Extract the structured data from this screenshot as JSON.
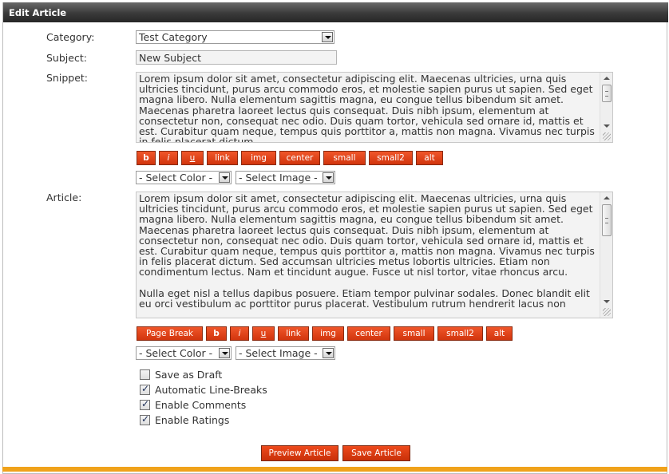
{
  "panel": {
    "title": "Edit Article"
  },
  "form": {
    "category_label": "Category:",
    "category_value": "Test Category",
    "subject_label": "Subject:",
    "subject_value": "New Subject",
    "snippet_label": "Snippet:",
    "snippet_text": "Lorem ipsum dolor sit amet, consectetur adipiscing elit. Maecenas ultricies, urna quis ultricies tincidunt, purus arcu commodo eros, et molestie sapien purus ut sapien. Sed eget magna libero. Nulla elementum sagittis magna, eu congue tellus bibendum sit amet. Maecenas pharetra laoreet lectus quis consequat. Duis nibh ipsum, elementum at consectetur non, consequat nec odio. Duis quam tortor, vehicula sed ornare id, mattis et est. Curabitur quam neque, tempus quis porttitor a, mattis non magna. Vivamus nec turpis in felis placerat dictum.",
    "article_label": "Article:",
    "article_text": "Lorem ipsum dolor sit amet, consectetur adipiscing elit. Maecenas ultricies, urna quis ultricies tincidunt, purus arcu commodo eros, et molestie sapien purus ut sapien. Sed eget magna libero. Nulla elementum sagittis magna, eu congue tellus bibendum sit amet. Maecenas pharetra laoreet lectus quis consequat. Duis nibh ipsum, elementum at consectetur non, consequat nec odio. Duis quam tortor, vehicula sed ornare id, mattis et est. Curabitur quam neque, tempus quis porttitor a, mattis non magna. Vivamus nec turpis in felis placerat dictum. Sed accumsan ultricies metus lobortis ultricies. Etiam non condimentum lectus. Nam et tincidunt augue. Fusce ut nisl tortor, vitae rhoncus arcu.\n\nNulla eget nisl a tellus dapibus posuere. Etiam tempor pulvinar sodales. Donec blandit elit eu orci vestibulum ac porttitor purus placerat. Vestibulum rutrum hendrerit lacus non"
  },
  "snippet_toolbar": {
    "bold": "b",
    "italic": "i",
    "underline": "u",
    "link": "link",
    "img": "img",
    "center": "center",
    "small": "small",
    "small2": "small2",
    "alt": "alt",
    "color_select": "- Select Color -",
    "image_select": "- Select Image -"
  },
  "article_toolbar": {
    "page_break": "Page Break",
    "bold": "b",
    "italic": "i",
    "underline": "u",
    "link": "link",
    "img": "img",
    "center": "center",
    "small": "small",
    "small2": "small2",
    "alt": "alt",
    "color_select": "- Select Color -",
    "image_select": "- Select Image -"
  },
  "options": [
    {
      "label": "Save as Draft",
      "checked": false
    },
    {
      "label": "Automatic Line-Breaks",
      "checked": true
    },
    {
      "label": "Enable Comments",
      "checked": true
    },
    {
      "label": "Enable Ratings",
      "checked": true
    }
  ],
  "actions": {
    "preview": "Preview Article",
    "save": "Save Article"
  },
  "colors": {
    "button": "#d9400f",
    "accent_bar": "#f0a21a",
    "titlebar": "#3a3a3a"
  },
  "icons": {
    "dropdown": "chevron-down-icon",
    "checkbox_mark": "check-icon"
  }
}
